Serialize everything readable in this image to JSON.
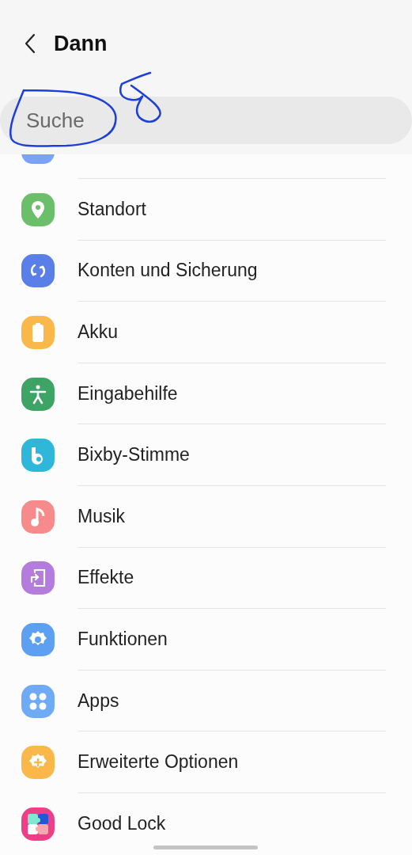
{
  "header": {
    "title": "Dann"
  },
  "search": {
    "placeholder": "Suche"
  },
  "items": [
    {
      "label": "Standort",
      "kind": "pin",
      "color": "#6cbf6a"
    },
    {
      "label": "Konten und Sicherung",
      "kind": "sync",
      "color": "#5b7fe8"
    },
    {
      "label": "Akku",
      "kind": "battery",
      "color": "#fbb84a"
    },
    {
      "label": "Eingabehilfe",
      "kind": "person",
      "color": "#3da466"
    },
    {
      "label": "Bixby-Stimme",
      "kind": "bixby",
      "color": "#2fb7d9"
    },
    {
      "label": "Musik",
      "kind": "note",
      "color": "#f78a8a"
    },
    {
      "label": "Effekte",
      "kind": "effects",
      "color": "#b47ddd"
    },
    {
      "label": "Funktionen",
      "kind": "gear",
      "color": "#5d9ff0"
    },
    {
      "label": "Apps",
      "kind": "apps",
      "color": "#6fabf5"
    },
    {
      "label": "Erweiterte Optionen",
      "kind": "gearplus",
      "color": "#fbb84a"
    },
    {
      "label": "Good Lock",
      "kind": "goodlock",
      "color": "#ec3f87"
    }
  ]
}
